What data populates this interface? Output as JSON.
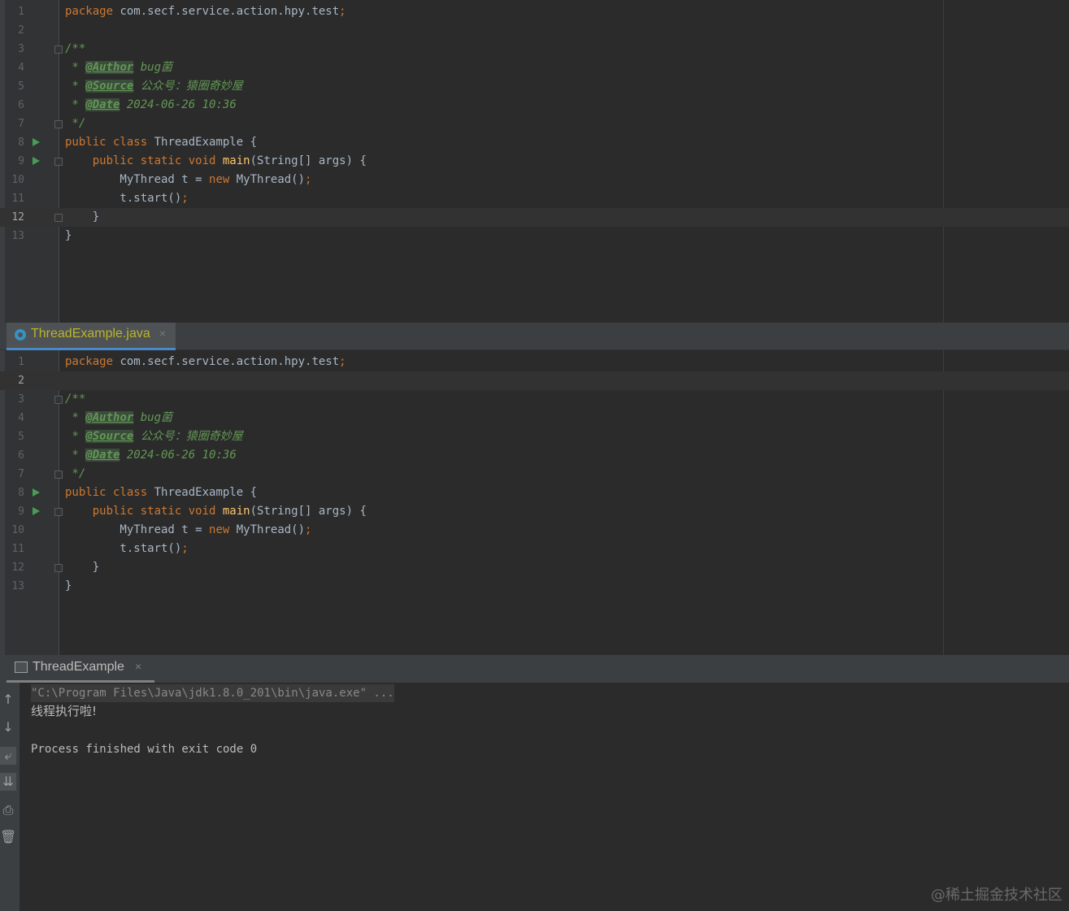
{
  "editor_top": {
    "lines": [
      {
        "n": "1",
        "html": "<span class='kw'>package</span> com.secf.service.action.hpy.test<span class='kw'>;</span>"
      },
      {
        "n": "2",
        "html": ""
      },
      {
        "n": "3",
        "html": "<span class='cm'>/**</span>"
      },
      {
        "n": "4",
        "html": "<span class='cm'> * </span><span class='tag'>@Author</span><span class='cm'> bug菌</span>"
      },
      {
        "n": "5",
        "html": "<span class='cm'> * </span><span class='tag'>@Source</span><span class='cm'> 公众号：猿圈奇妙屋</span>"
      },
      {
        "n": "6",
        "html": "<span class='cm'> * </span><span class='tag'>@Date</span><span class='cm'> 2024-06-26 10:36</span>"
      },
      {
        "n": "7",
        "html": "<span class='cm'> */</span>"
      },
      {
        "n": "8",
        "html": "<span class='kw'>public class</span> ThreadExample {"
      },
      {
        "n": "9",
        "html": "    <span class='kw'>public static void</span> <span class='fn'>main</span>(String[] args) {"
      },
      {
        "n": "10",
        "html": "        MyThread t = <span class='kw'>new</span> MyThread()<span class='kw'>;</span>"
      },
      {
        "n": "11",
        "html": "        t.start()<span class='kw'>;</span>"
      },
      {
        "n": "12",
        "html": "    }"
      },
      {
        "n": "13",
        "html": "}"
      }
    ],
    "current_line": "12"
  },
  "tab": {
    "label": "ThreadExample.java",
    "close": "×"
  },
  "editor_bottom": {
    "lines": [
      {
        "n": "1",
        "html": "<span class='kw'>package</span> com.secf.service.action.hpy.test<span class='kw'>;</span>"
      },
      {
        "n": "2",
        "html": ""
      },
      {
        "n": "3",
        "html": "<span class='cm'>/**</span>"
      },
      {
        "n": "4",
        "html": "<span class='cm'> * </span><span class='tag'>@Author</span><span class='cm'> bug菌</span>"
      },
      {
        "n": "5",
        "html": "<span class='cm'> * </span><span class='tag'>@Source</span><span class='cm'> 公众号：猿圈奇妙屋</span>"
      },
      {
        "n": "6",
        "html": "<span class='cm'> * </span><span class='tag'>@Date</span><span class='cm'> 2024-06-26 10:36</span>"
      },
      {
        "n": "7",
        "html": "<span class='cm'> */</span>"
      },
      {
        "n": "8",
        "html": "<span class='kw'>public class</span> ThreadExample {"
      },
      {
        "n": "9",
        "html": "    <span class='kw'>public static void</span> <span class='fn'>main</span>(String[] args) {"
      },
      {
        "n": "10",
        "html": "        MyThread t = <span class='kw'>new</span> MyThread()<span class='kw'>;</span>"
      },
      {
        "n": "11",
        "html": "        t.start()<span class='kw'>;</span>"
      },
      {
        "n": "12",
        "html": "    }"
      },
      {
        "n": "13",
        "html": "}"
      }
    ],
    "current_line": "2"
  },
  "run_tab": {
    "label": "ThreadExample",
    "close": "×"
  },
  "console": {
    "command": "\"C:\\Program Files\\Java\\jdk1.8.0_201\\bin\\java.exe\" ...",
    "output": "线程执行啦!",
    "exit": "Process finished with exit code 0"
  },
  "watermark": "@稀土掘金技术社区"
}
